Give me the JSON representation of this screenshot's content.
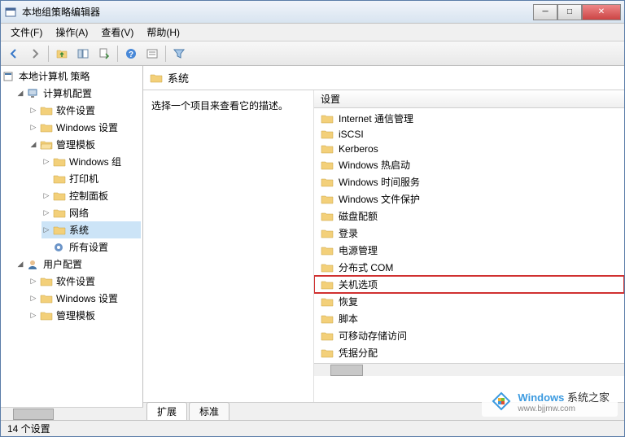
{
  "window": {
    "title": "本地组策略编辑器"
  },
  "menu": {
    "file": "文件(F)",
    "action": "操作(A)",
    "view": "查看(V)",
    "help": "帮助(H)"
  },
  "tree": {
    "root": "本地计算机 策略",
    "computer_config": "计算机配置",
    "software_settings": "软件设置",
    "windows_settings": "Windows 设置",
    "admin_templates": "管理模板",
    "windows_components": "Windows 组",
    "printers": "打印机",
    "control_panel": "控制面板",
    "network": "网络",
    "system": "系统",
    "all_settings": "所有设置",
    "user_config": "用户配置",
    "user_software": "软件设置",
    "user_windows": "Windows 设置",
    "user_admin": "管理模板"
  },
  "content": {
    "header": "系统",
    "description": "选择一个项目来查看它的描述。",
    "column_header": "设置"
  },
  "items": [
    "Internet 通信管理",
    "iSCSI",
    "Kerberos",
    "Windows 热启动",
    "Windows 时间服务",
    "Windows 文件保护",
    "磁盘配额",
    "登录",
    "电源管理",
    "分布式 COM",
    "关机选项",
    "恢复",
    "脚本",
    "可移动存储访问",
    "凭据分配"
  ],
  "highlighted_index": 10,
  "tabs": {
    "extended": "扩展",
    "standard": "标准"
  },
  "statusbar": {
    "count": "14 个设置"
  },
  "watermark": {
    "brand": "Windows",
    "text": "系统之家",
    "url": "www.bjjmw.com"
  }
}
